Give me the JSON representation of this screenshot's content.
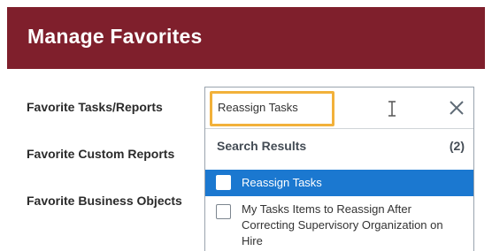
{
  "header": {
    "title": "Manage Favorites"
  },
  "fields": {
    "tasks_reports_label": "Favorite Tasks/Reports",
    "custom_reports_label": "Favorite Custom Reports",
    "business_objects_label": "Favorite Business Objects"
  },
  "prompt": {
    "search_value": "Reassign Tasks",
    "results_title": "Search Results",
    "results_count": "(2)",
    "results": [
      {
        "label": "Reassign Tasks",
        "selected": true
      },
      {
        "label": "My Tasks Items to Reassign After Correcting Supervisory Organization on Hire",
        "selected": false
      }
    ]
  },
  "icons": {
    "clear": "close-icon",
    "cursor": "text-cursor-icon",
    "checkbox": "checkbox-icon"
  },
  "colors": {
    "header_bg": "#7f1f2c",
    "highlight": "#f2b13a",
    "selected_row": "#1b78d0"
  }
}
